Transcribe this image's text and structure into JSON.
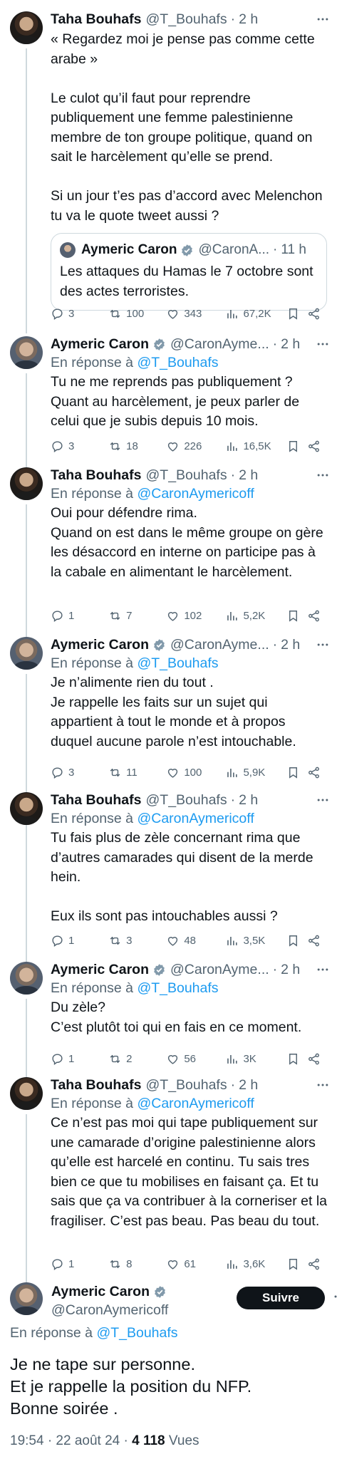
{
  "tweets": [
    {
      "name": "Taha Bouhafs",
      "handle": "@T_Bouhafs",
      "time": "2 h",
      "text": "« Regardez moi je pense pas comme cette arabe »\n\nLe culot qu’il faut pour reprendre publiquement une femme palestinienne membre de ton groupe politique, quand on sait le harcèlement qu’elle se prend.\n\nSi un jour t’es pas d’accord avec Melenchon tu va le quote tweet aussi ?",
      "quote": {
        "name": "Aymeric Caron",
        "handle": "@CaronA...",
        "time": "11 h",
        "text": "Les attaques du Hamas le 7 octobre sont des actes terroristes."
      },
      "stats": {
        "replies": "3",
        "retweets": "100",
        "likes": "343",
        "views": "67,2K"
      }
    },
    {
      "name": "Aymeric Caron",
      "handle": "@CaronAyme...",
      "time": "2 h",
      "reply_prefix": "En réponse à",
      "reply_to": "@T_Bouhafs",
      "text": "Tu ne me reprends pas publiquement ?\nQuant au harcèlement, je peux parler de celui que je subis depuis 10 mois.",
      "stats": {
        "replies": "3",
        "retweets": "18",
        "likes": "226",
        "views": "16,5K"
      }
    },
    {
      "name": "Taha Bouhafs",
      "handle": "@T_Bouhafs",
      "time": "2 h",
      "reply_prefix": "En réponse à",
      "reply_to": "@CaronAymericoff",
      "text": "Oui pour défendre rima.\nQuand on est dans le même groupe on gère les désaccord en interne on participe pas à la cabale en alimentant le harcèlement.",
      "stats": {
        "replies": "1",
        "retweets": "7",
        "likes": "102",
        "views": "5,2K"
      }
    },
    {
      "name": "Aymeric Caron",
      "handle": "@CaronAyme...",
      "time": "2 h",
      "reply_prefix": "En réponse à",
      "reply_to": "@T_Bouhafs",
      "text": "Je n’alimente rien du tout .\nJe rappelle les faits sur un sujet qui appartient à tout le monde et à propos duquel aucune parole n’est intouchable.",
      "stats": {
        "replies": "3",
        "retweets": "11",
        "likes": "100",
        "views": "5,9K"
      }
    },
    {
      "name": "Taha Bouhafs",
      "handle": "@T_Bouhafs",
      "time": "2 h",
      "reply_prefix": "En réponse à",
      "reply_to": "@CaronAymericoff",
      "text": "Tu fais plus de zèle concernant rima que d’autres camarades qui disent de la merde hein.\n\nEux ils sont pas intouchables aussi ?",
      "stats": {
        "replies": "1",
        "retweets": "3",
        "likes": "48",
        "views": "3,5K"
      }
    },
    {
      "name": "Aymeric Caron",
      "handle": "@CaronAyme...",
      "time": "2 h",
      "reply_prefix": "En réponse à",
      "reply_to": "@T_Bouhafs",
      "text": "Du zèle?\nC’est plutôt toi qui en fais en ce moment.",
      "stats": {
        "replies": "1",
        "retweets": "2",
        "likes": "56",
        "views": "3K"
      }
    },
    {
      "name": "Taha Bouhafs",
      "handle": "@T_Bouhafs",
      "time": "2 h",
      "reply_prefix": "En réponse à",
      "reply_to": "@CaronAymericoff",
      "text": "Ce n’est pas moi qui tape publiquement sur une camarade d’origine palestinienne alors qu’elle est harcelé en continu. Tu sais tres bien ce que tu mobilises en faisant ça. Et tu sais que ça va contribuer à la corneriser et la fragiliser. C’est pas beau. Pas beau du tout.",
      "stats": {
        "replies": "1",
        "retweets": "8",
        "likes": "61",
        "views": "3,6K"
      }
    }
  ],
  "main": {
    "name": "Aymeric Caron",
    "handle": "@CaronAymericoff",
    "follow_label": "Suivre",
    "reply_prefix": "En réponse à",
    "reply_to": "@T_Bouhafs",
    "text": "Je ne tape sur personne.\nEt je rappelle la position du NFP.\nBonne soirée .",
    "timestamp": "19:54 · 22 août 24 · ",
    "views_count": "4 118",
    "views_label": " Vues"
  },
  "colors": {
    "text": "#0f1419",
    "secondary": "#536471",
    "link": "#1d9bf0",
    "verified": "#829aab",
    "border": "#cfd9de"
  }
}
